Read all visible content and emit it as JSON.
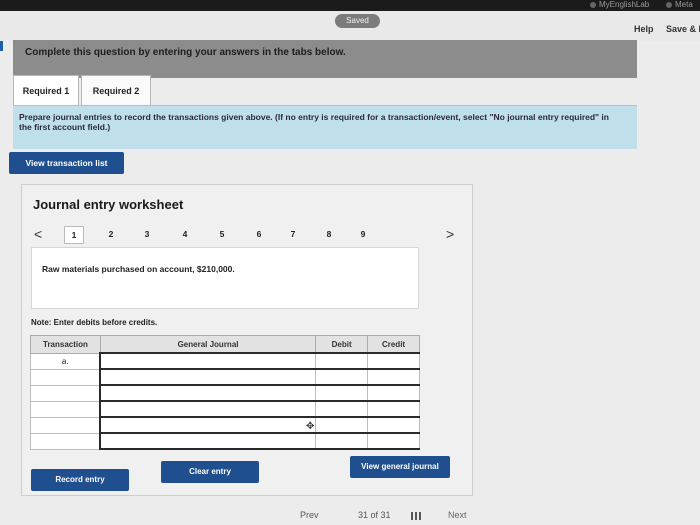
{
  "topbar": {
    "extensions": [
      "MyEnglishLab",
      "Meta"
    ]
  },
  "header": {
    "saved_label": "Saved",
    "help_label": "Help",
    "save_exit_label": "Save & E"
  },
  "banner": {
    "text": "Complete this question by entering your answers in the tabs below."
  },
  "tabs": [
    {
      "label": "Required 1",
      "active": true
    },
    {
      "label": "Required 2",
      "active": false
    }
  ],
  "prompt": {
    "text": "Prepare journal entries to record the transactions given above. (If no entry is required for a transaction/event, select \"No journal entry required\" in the first account field.)"
  },
  "view_transaction_list_label": "View transaction list",
  "worksheet": {
    "title": "Journal entry worksheet",
    "prev_arrow": "<",
    "next_arrow": ">",
    "pages": [
      "1",
      "2",
      "3",
      "4",
      "5",
      "6",
      "7",
      "8",
      "9"
    ],
    "active_page": "1",
    "description": "Raw materials purchased on account, $210,000.",
    "note": "Note: Enter debits before credits.",
    "table": {
      "headers": [
        "Transaction",
        "General Journal",
        "Debit",
        "Credit"
      ],
      "rows": [
        {
          "transaction": "a.",
          "account": "",
          "debit": "",
          "credit": ""
        },
        {
          "transaction": "",
          "account": "",
          "debit": "",
          "credit": ""
        },
        {
          "transaction": "",
          "account": "",
          "debit": "",
          "credit": ""
        },
        {
          "transaction": "",
          "account": "",
          "debit": "",
          "credit": ""
        },
        {
          "transaction": "",
          "account": "",
          "debit": "",
          "credit": ""
        },
        {
          "transaction": "",
          "account": "",
          "debit": "",
          "credit": ""
        }
      ]
    },
    "buttons": {
      "record": "Record entry",
      "clear": "Clear entry",
      "view_general_journal": "View general journal"
    }
  },
  "bottom_nav": {
    "prev": "Prev",
    "page_count": "31 of 31",
    "next": "Next"
  }
}
